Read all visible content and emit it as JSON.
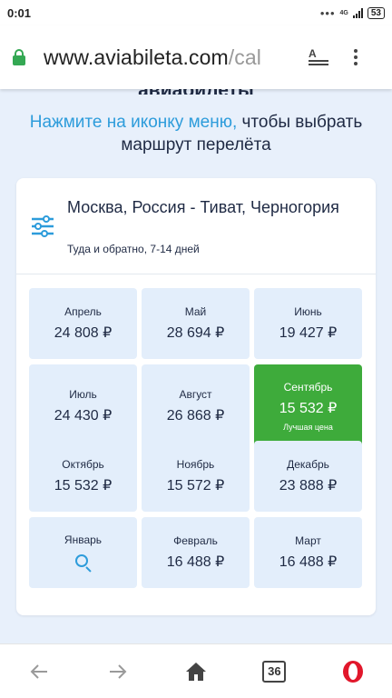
{
  "status_bar": {
    "time": "0:01",
    "dots": "•••",
    "network": "4G",
    "battery": "53"
  },
  "browser": {
    "url_main": "www.aviabileta.com",
    "url_rest": "/cal",
    "tabs_count": "36"
  },
  "page": {
    "heading_partial": "авиабилеты",
    "hint_link": "Нажмите на иконку меню,",
    "hint_rest": " чтобы выбрать маршрут перелёта"
  },
  "route": {
    "title": "Москва, Россия - Тиват, Черногория",
    "subtitle": "Туда и обратно, 7-14 дней"
  },
  "months": [
    {
      "name": "Апрель",
      "price": "24 808 ₽"
    },
    {
      "name": "Май",
      "price": "28 694 ₽"
    },
    {
      "name": "Июнь",
      "price": "19 427 ₽"
    },
    {
      "name": "Июль",
      "price": "24 430 ₽"
    },
    {
      "name": "Август",
      "price": "26 868 ₽"
    },
    {
      "name": "Сентябрь",
      "price": "15 532 ₽",
      "note": "Лучшая цена"
    },
    {
      "name": "Октябрь",
      "price": "15 532 ₽"
    },
    {
      "name": "Ноябрь",
      "price": "15 572 ₽"
    },
    {
      "name": "Декабрь",
      "price": "23 888 ₽"
    },
    {
      "name": "Январь",
      "icon": "search-icon"
    },
    {
      "name": "Февраль",
      "price": "16 488 ₽"
    },
    {
      "name": "Март",
      "price": "16 488 ₽"
    }
  ],
  "colors": {
    "accent_blue": "#2d9cdb",
    "best_green": "#3eab3b",
    "cell_bg": "#e3eefb",
    "page_bg": "#e8f0fb",
    "opera_red": "#e1172b"
  },
  "icons": {
    "lock": "lock-icon",
    "reader": "reader-mode-icon",
    "menu": "more-vert-icon",
    "filter": "filter-sliders-icon",
    "back": "back-arrow-icon",
    "forward": "forward-arrow-icon",
    "home": "home-icon",
    "tabs": "tabs-icon",
    "opera": "opera-menu-icon"
  }
}
